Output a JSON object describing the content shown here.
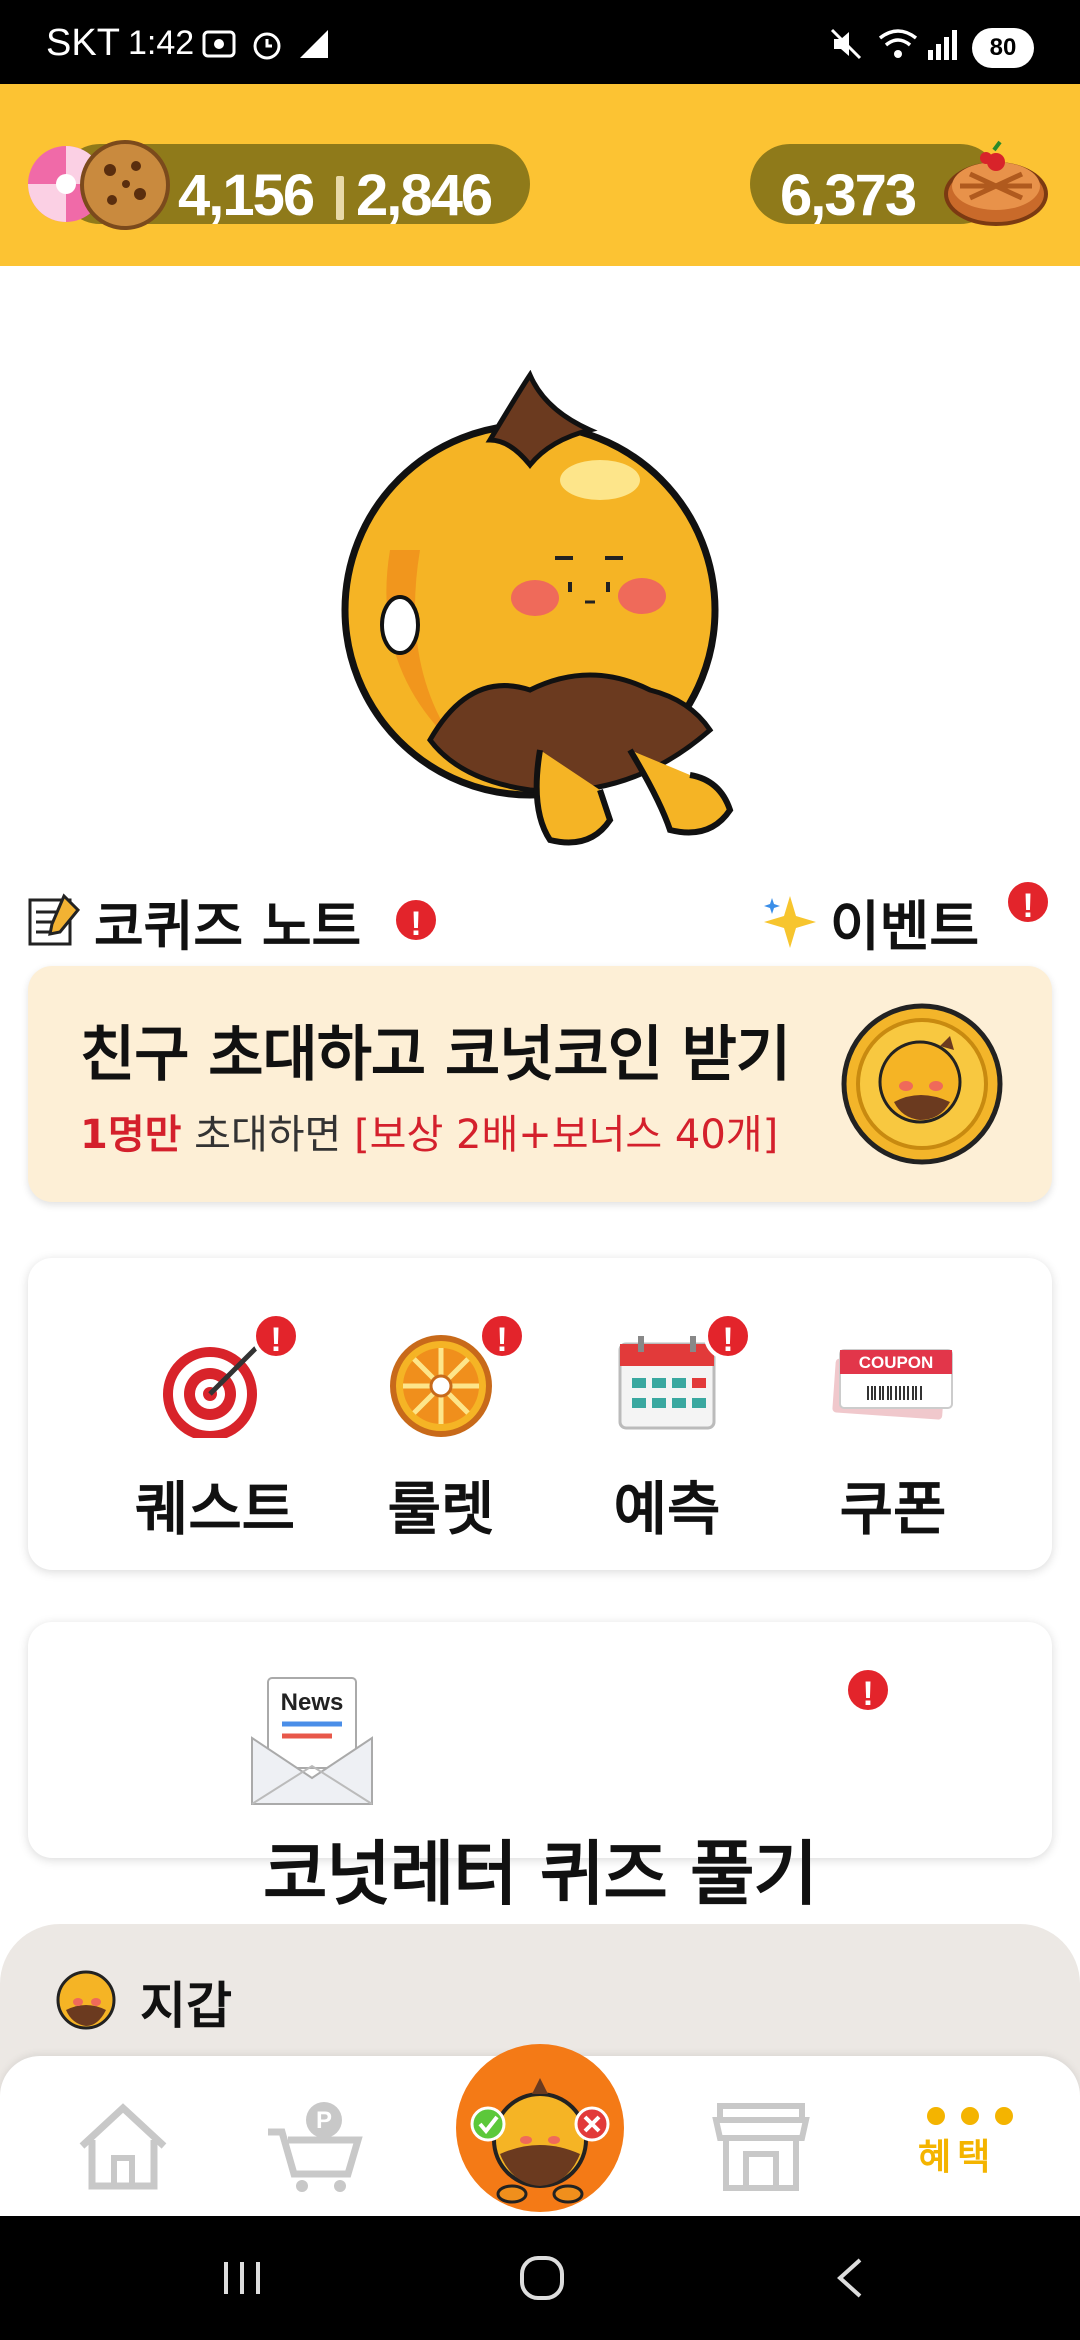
{
  "status_bar": {
    "carrier": "SKT",
    "time": "1:42",
    "battery": "80"
  },
  "currency": {
    "candy_count": "4,156",
    "cookie_count": "2,846",
    "pie_count": "6,373"
  },
  "sections": {
    "quiz_note": "코퀴즈 노트",
    "event": "이벤트"
  },
  "invite": {
    "title": "친구 초대하고 코넛코인 받기",
    "count": "1명만",
    "middle": " 초대하면 ",
    "reward": "[보상 2배+보너스 40개]"
  },
  "menu": {
    "items": [
      {
        "label": "퀘스트",
        "icon": "target-icon",
        "alert": true
      },
      {
        "label": "룰렛",
        "icon": "roulette-icon",
        "alert": true
      },
      {
        "label": "예측",
        "icon": "calendar-icon",
        "alert": true
      },
      {
        "label": "쿠폰",
        "icon": "coupon-icon",
        "alert": false
      }
    ]
  },
  "news": {
    "icon_label": "News",
    "title": "코넛레터 퀴즈 풀기"
  },
  "wallet": {
    "label": "지갑"
  },
  "bottom_nav": {
    "items": [
      "home-icon",
      "point-cart-icon",
      "quiz-center-icon",
      "store-icon",
      "benefit-icon"
    ],
    "benefit_label": "혜택"
  },
  "coupon_text": "COUPON",
  "colors": {
    "brand_yellow": "#fcc333",
    "pill_olive": "#8f7a1a",
    "alert_red": "#e3242b",
    "invite_bg": "#fdefd6",
    "accent_orange": "#f47a16"
  }
}
